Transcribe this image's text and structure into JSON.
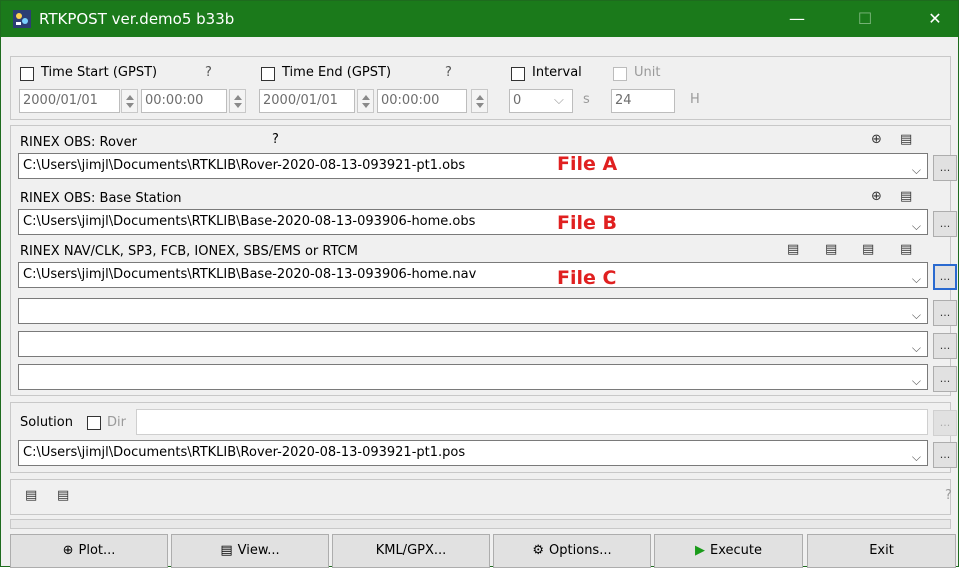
{
  "window": {
    "title": "RTKPOST ver.demo5 b33b",
    "minimize": "—",
    "maximize": "☐",
    "close": "✕"
  },
  "time": {
    "start_label": "Time Start (GPST)",
    "start_help": "?",
    "start_date": "2000/01/01",
    "start_time": "00:00:00",
    "end_label": "Time End (GPST)",
    "end_help": "?",
    "end_date": "2000/01/01",
    "end_time": "00:00:00",
    "interval_label": "Interval",
    "interval_value": "0",
    "interval_unit": "s",
    "unit_label": "Unit",
    "unit_value": "24",
    "unit_suffix": "H"
  },
  "inputs": {
    "rover_label": "RINEX OBS: Rover",
    "rover_help": "?",
    "rover_file": "C:\\Users\\jimjl\\Documents\\RTKLIB\\Rover-2020-08-13-093921-pt1.obs",
    "rover_annot": "File A",
    "base_label": "RINEX OBS: Base Station",
    "base_file": "C:\\Users\\jimjl\\Documents\\RTKLIB\\Base-2020-08-13-093906-home.obs",
    "base_annot": "File B",
    "nav_label": "RINEX NAV/CLK, SP3, FCB, IONEX, SBS/EMS  or RTCM",
    "nav_file": "C:\\Users\\jimjl\\Documents\\RTKLIB\\Base-2020-08-13-093906-home.nav",
    "nav_annot": "File C",
    "browse": "...",
    "chevron": "⌵"
  },
  "solution": {
    "label": "Solution",
    "dir_label": "Dir",
    "file": "C:\\Users\\jimjl\\Documents\\RTKLIB\\Rover-2020-08-13-093921-pt1.pos"
  },
  "status": {
    "help": "?"
  },
  "buttons": {
    "plot": "Plot...",
    "view": "View...",
    "kml": "KML/GPX...",
    "options": "Options...",
    "execute": "Execute",
    "exit": "Exit"
  },
  "colors": {
    "titlebar": "#1b7a1b",
    "annotation": "#e02020",
    "focus": "#2a6ad0"
  }
}
